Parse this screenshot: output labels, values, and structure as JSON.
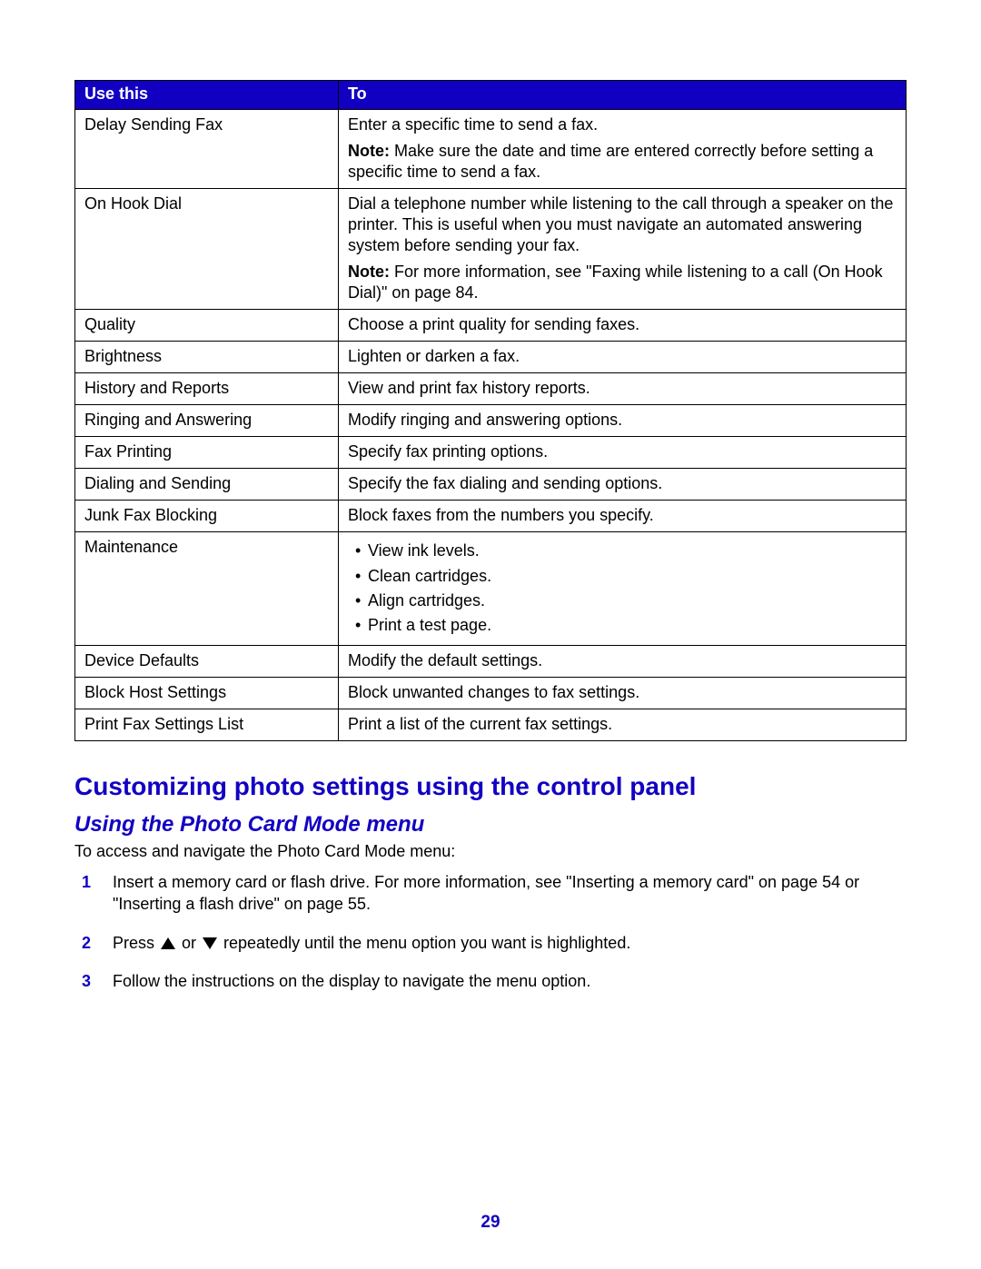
{
  "table": {
    "headers": {
      "col1": "Use this",
      "col2": "To"
    },
    "rows": [
      {
        "name": "Delay Sending Fax",
        "desc": "Enter a specific time to send a fax.",
        "note": "Make sure the date and time are entered correctly before setting a specific time to send a fax."
      },
      {
        "name": "On Hook Dial",
        "desc": "Dial a telephone number while listening to the call through a speaker on the printer. This is useful when you must navigate an automated answering system before sending your fax.",
        "note": "For more information, see \"Faxing while listening to a call (On Hook Dial)\" on page 84."
      },
      {
        "name": "Quality",
        "desc": "Choose a print quality for sending faxes."
      },
      {
        "name": "Brightness",
        "desc": "Lighten or darken a fax."
      },
      {
        "name": "History and Reports",
        "desc": "View and print fax history reports."
      },
      {
        "name": "Ringing and Answering",
        "desc": "Modify ringing and answering options."
      },
      {
        "name": "Fax Printing",
        "desc": "Specify fax printing options."
      },
      {
        "name": "Dialing and Sending",
        "desc": "Specify the fax dialing and sending options."
      },
      {
        "name": "Junk Fax Blocking",
        "desc": "Block faxes from the numbers you specify."
      },
      {
        "name": "Maintenance",
        "bullets": [
          "View ink levels.",
          "Clean cartridges.",
          "Align cartridges.",
          "Print a test page."
        ]
      },
      {
        "name": "Device Defaults",
        "desc": "Modify the default settings."
      },
      {
        "name": "Block Host Settings",
        "desc": "Block unwanted changes to fax settings."
      },
      {
        "name": "Print Fax Settings List",
        "desc": "Print a list of the current fax settings."
      }
    ],
    "note_label": "Note:"
  },
  "heading1": "Customizing photo settings using the control panel",
  "heading2": "Using the Photo Card Mode menu",
  "intro": "To access and navigate the Photo Card Mode menu:",
  "steps": {
    "s1": "Insert a memory card or flash drive. For more information, see \"Inserting a memory card\" on page 54 or \"Inserting a flash drive\" on page 55.",
    "s2a": "Press ",
    "s2b": " or ",
    "s2c": " repeatedly until the menu option you want is highlighted.",
    "s3": "Follow the instructions on the display to navigate the menu option."
  },
  "step_numbers": {
    "n1": "1",
    "n2": "2",
    "n3": "3"
  },
  "page_number": "29"
}
